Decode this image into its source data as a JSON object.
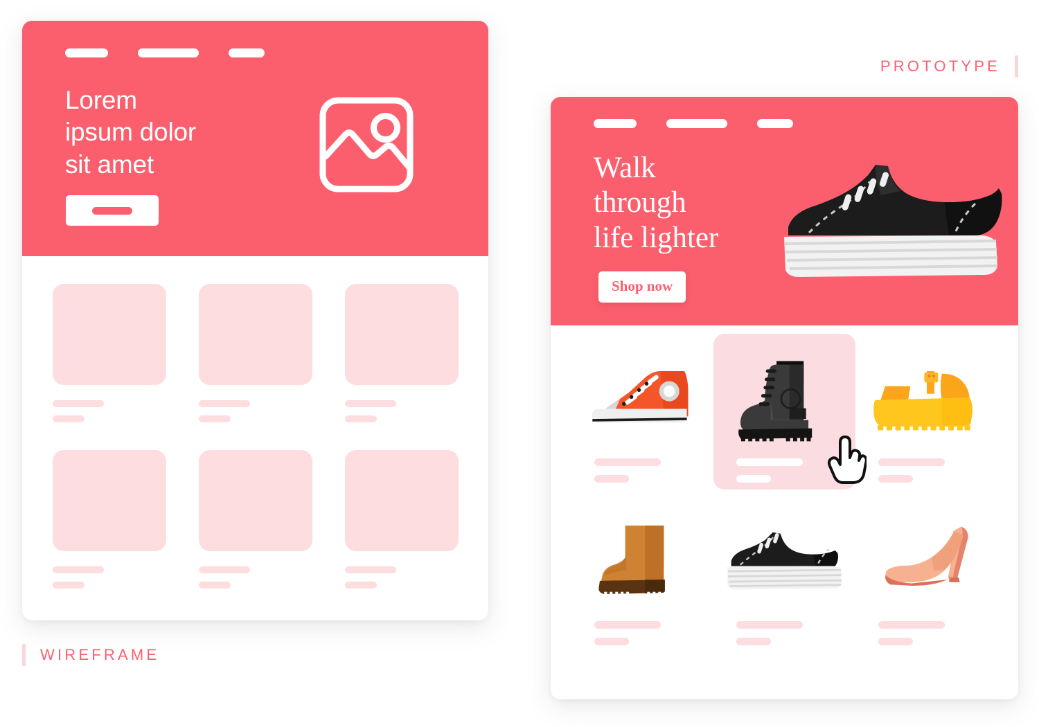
{
  "wireframe": {
    "label": "WIREFRAME",
    "nav_items": [
      "nav-dash-1",
      "nav-dash-2",
      "nav-dash-3"
    ],
    "heading": "Lorem\nipsum dolor\nsit amet",
    "cta_label": "",
    "image_placeholder_icon": "image-placeholder-icon",
    "grid_items": [
      {
        "thumb": "thumb-placeholder",
        "line_long": "",
        "line_short": ""
      },
      {
        "thumb": "thumb-placeholder",
        "line_long": "",
        "line_short": ""
      },
      {
        "thumb": "thumb-placeholder",
        "line_long": "",
        "line_short": ""
      },
      {
        "thumb": "thumb-placeholder",
        "line_long": "",
        "line_short": ""
      },
      {
        "thumb": "thumb-placeholder",
        "line_long": "",
        "line_short": ""
      },
      {
        "thumb": "thumb-placeholder",
        "line_long": "",
        "line_short": ""
      }
    ]
  },
  "prototype": {
    "label": "PROTOTYPE",
    "nav_items": [
      "nav-dash-1",
      "nav-dash-2",
      "nav-dash-3"
    ],
    "heading": "Walk\nthrough\nlife lighter",
    "shop_now_label": "Shop now",
    "hero_shoe_icon": "black-platform-sneaker-icon",
    "cursor_icon": "pointing-hand-cursor-icon",
    "products": [
      {
        "icon": "red-high-top-sneaker-icon",
        "selected": false
      },
      {
        "icon": "black-combat-boot-icon",
        "selected": true
      },
      {
        "icon": "yellow-wedge-sandal-icon",
        "selected": false
      },
      {
        "icon": "tan-ugg-boot-icon",
        "selected": false
      },
      {
        "icon": "black-platform-sneaker-icon",
        "selected": false
      },
      {
        "icon": "peach-high-heel-icon",
        "selected": false
      }
    ]
  },
  "colors": {
    "coral": "#FB5F6E",
    "pale_pink": "#FDDDE0",
    "selected_card": "#FBDCE0",
    "label_bar": "#FBD5D9",
    "white": "#FFFFFF",
    "sneaker_red": "#F4562A",
    "sandal_yellow": "#FFC71E",
    "ugg_tan": "#D08233",
    "heel_peach": "#F6B190",
    "boot_black": "#2B2B2B"
  }
}
